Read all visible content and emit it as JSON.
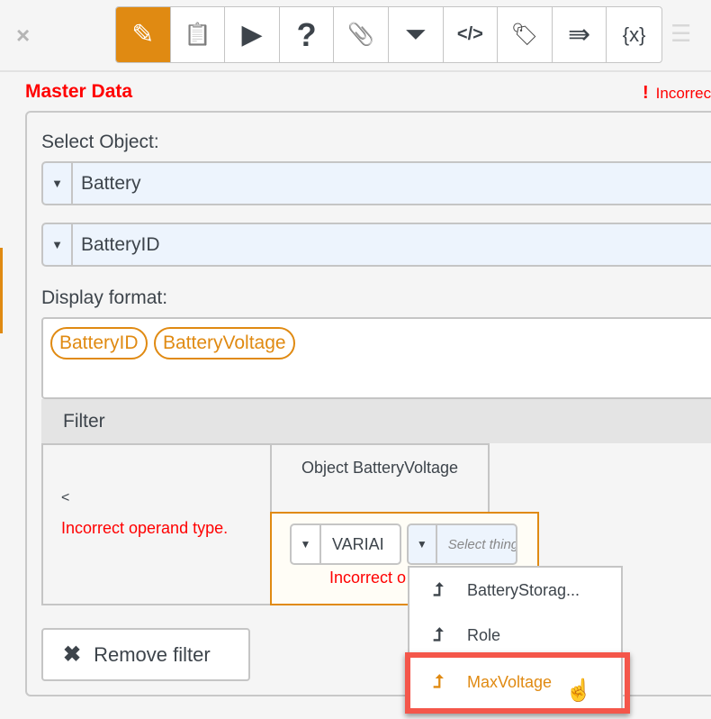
{
  "toolbar": {
    "close": "×",
    "buttons": [
      {
        "name": "pencil-icon",
        "glyph": "✎"
      },
      {
        "name": "checklist-icon",
        "glyph": "📋"
      },
      {
        "name": "play-icon",
        "glyph": "▶"
      },
      {
        "name": "help-icon",
        "glyph": "?"
      },
      {
        "name": "paperclip-icon",
        "glyph": "📎"
      },
      {
        "name": "filter-icon",
        "glyph": "⏷"
      },
      {
        "name": "code-icon",
        "glyph": "</>"
      },
      {
        "name": "tags-icon",
        "glyph": "🏷"
      },
      {
        "name": "forward-icon",
        "glyph": "⇛"
      },
      {
        "name": "variable-icon",
        "glyph": "{x}"
      }
    ],
    "list": "☰",
    "active_color": "#e08a12"
  },
  "section": {
    "title": "Master Data",
    "error_mark": "!",
    "error": "Incorrect"
  },
  "form": {
    "select_object_label": "Select Object:",
    "object": "Battery",
    "attribute": "BatteryID",
    "display_format_label": "Display format:",
    "chips": [
      "BatteryID",
      "BatteryVoltage"
    ]
  },
  "filter": {
    "title": "Filter",
    "operator": "<",
    "operator_error": "Incorrect operand type.",
    "left_operand": "Object BatteryVoltage",
    "type_value": "VARIAI",
    "attr_placeholder": "Select thing",
    "right_error": "Incorrect operand type.",
    "options": [
      "BatteryStorag...",
      "Role",
      "MaxVoltage"
    ],
    "remove_label": "Remove filter"
  }
}
